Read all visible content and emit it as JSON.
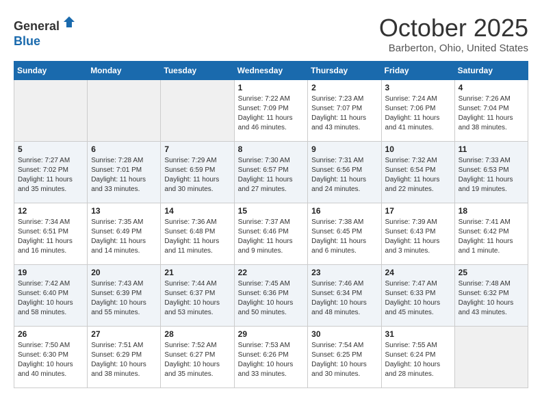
{
  "header": {
    "logo_line1": "General",
    "logo_line2": "Blue",
    "month_title": "October 2025",
    "location": "Barberton, Ohio, United States"
  },
  "days_of_week": [
    "Sunday",
    "Monday",
    "Tuesday",
    "Wednesday",
    "Thursday",
    "Friday",
    "Saturday"
  ],
  "weeks": [
    [
      {
        "day": "",
        "empty": true
      },
      {
        "day": "",
        "empty": true
      },
      {
        "day": "",
        "empty": true
      },
      {
        "day": "1",
        "sunrise": "7:22 AM",
        "sunset": "7:09 PM",
        "daylight": "11 hours and 46 minutes."
      },
      {
        "day": "2",
        "sunrise": "7:23 AM",
        "sunset": "7:07 PM",
        "daylight": "11 hours and 43 minutes."
      },
      {
        "day": "3",
        "sunrise": "7:24 AM",
        "sunset": "7:06 PM",
        "daylight": "11 hours and 41 minutes."
      },
      {
        "day": "4",
        "sunrise": "7:26 AM",
        "sunset": "7:04 PM",
        "daylight": "11 hours and 38 minutes."
      }
    ],
    [
      {
        "day": "5",
        "sunrise": "7:27 AM",
        "sunset": "7:02 PM",
        "daylight": "11 hours and 35 minutes."
      },
      {
        "day": "6",
        "sunrise": "7:28 AM",
        "sunset": "7:01 PM",
        "daylight": "11 hours and 33 minutes."
      },
      {
        "day": "7",
        "sunrise": "7:29 AM",
        "sunset": "6:59 PM",
        "daylight": "11 hours and 30 minutes."
      },
      {
        "day": "8",
        "sunrise": "7:30 AM",
        "sunset": "6:57 PM",
        "daylight": "11 hours and 27 minutes."
      },
      {
        "day": "9",
        "sunrise": "7:31 AM",
        "sunset": "6:56 PM",
        "daylight": "11 hours and 24 minutes."
      },
      {
        "day": "10",
        "sunrise": "7:32 AM",
        "sunset": "6:54 PM",
        "daylight": "11 hours and 22 minutes."
      },
      {
        "day": "11",
        "sunrise": "7:33 AM",
        "sunset": "6:53 PM",
        "daylight": "11 hours and 19 minutes."
      }
    ],
    [
      {
        "day": "12",
        "sunrise": "7:34 AM",
        "sunset": "6:51 PM",
        "daylight": "11 hours and 16 minutes."
      },
      {
        "day": "13",
        "sunrise": "7:35 AM",
        "sunset": "6:49 PM",
        "daylight": "11 hours and 14 minutes."
      },
      {
        "day": "14",
        "sunrise": "7:36 AM",
        "sunset": "6:48 PM",
        "daylight": "11 hours and 11 minutes."
      },
      {
        "day": "15",
        "sunrise": "7:37 AM",
        "sunset": "6:46 PM",
        "daylight": "11 hours and 9 minutes."
      },
      {
        "day": "16",
        "sunrise": "7:38 AM",
        "sunset": "6:45 PM",
        "daylight": "11 hours and 6 minutes."
      },
      {
        "day": "17",
        "sunrise": "7:39 AM",
        "sunset": "6:43 PM",
        "daylight": "11 hours and 3 minutes."
      },
      {
        "day": "18",
        "sunrise": "7:41 AM",
        "sunset": "6:42 PM",
        "daylight": "11 hours and 1 minute."
      }
    ],
    [
      {
        "day": "19",
        "sunrise": "7:42 AM",
        "sunset": "6:40 PM",
        "daylight": "10 hours and 58 minutes."
      },
      {
        "day": "20",
        "sunrise": "7:43 AM",
        "sunset": "6:39 PM",
        "daylight": "10 hours and 55 minutes."
      },
      {
        "day": "21",
        "sunrise": "7:44 AM",
        "sunset": "6:37 PM",
        "daylight": "10 hours and 53 minutes."
      },
      {
        "day": "22",
        "sunrise": "7:45 AM",
        "sunset": "6:36 PM",
        "daylight": "10 hours and 50 minutes."
      },
      {
        "day": "23",
        "sunrise": "7:46 AM",
        "sunset": "6:34 PM",
        "daylight": "10 hours and 48 minutes."
      },
      {
        "day": "24",
        "sunrise": "7:47 AM",
        "sunset": "6:33 PM",
        "daylight": "10 hours and 45 minutes."
      },
      {
        "day": "25",
        "sunrise": "7:48 AM",
        "sunset": "6:32 PM",
        "daylight": "10 hours and 43 minutes."
      }
    ],
    [
      {
        "day": "26",
        "sunrise": "7:50 AM",
        "sunset": "6:30 PM",
        "daylight": "10 hours and 40 minutes."
      },
      {
        "day": "27",
        "sunrise": "7:51 AM",
        "sunset": "6:29 PM",
        "daylight": "10 hours and 38 minutes."
      },
      {
        "day": "28",
        "sunrise": "7:52 AM",
        "sunset": "6:27 PM",
        "daylight": "10 hours and 35 minutes."
      },
      {
        "day": "29",
        "sunrise": "7:53 AM",
        "sunset": "6:26 PM",
        "daylight": "10 hours and 33 minutes."
      },
      {
        "day": "30",
        "sunrise": "7:54 AM",
        "sunset": "6:25 PM",
        "daylight": "10 hours and 30 minutes."
      },
      {
        "day": "31",
        "sunrise": "7:55 AM",
        "sunset": "6:24 PM",
        "daylight": "10 hours and 28 minutes."
      },
      {
        "day": "",
        "empty": true
      }
    ]
  ]
}
